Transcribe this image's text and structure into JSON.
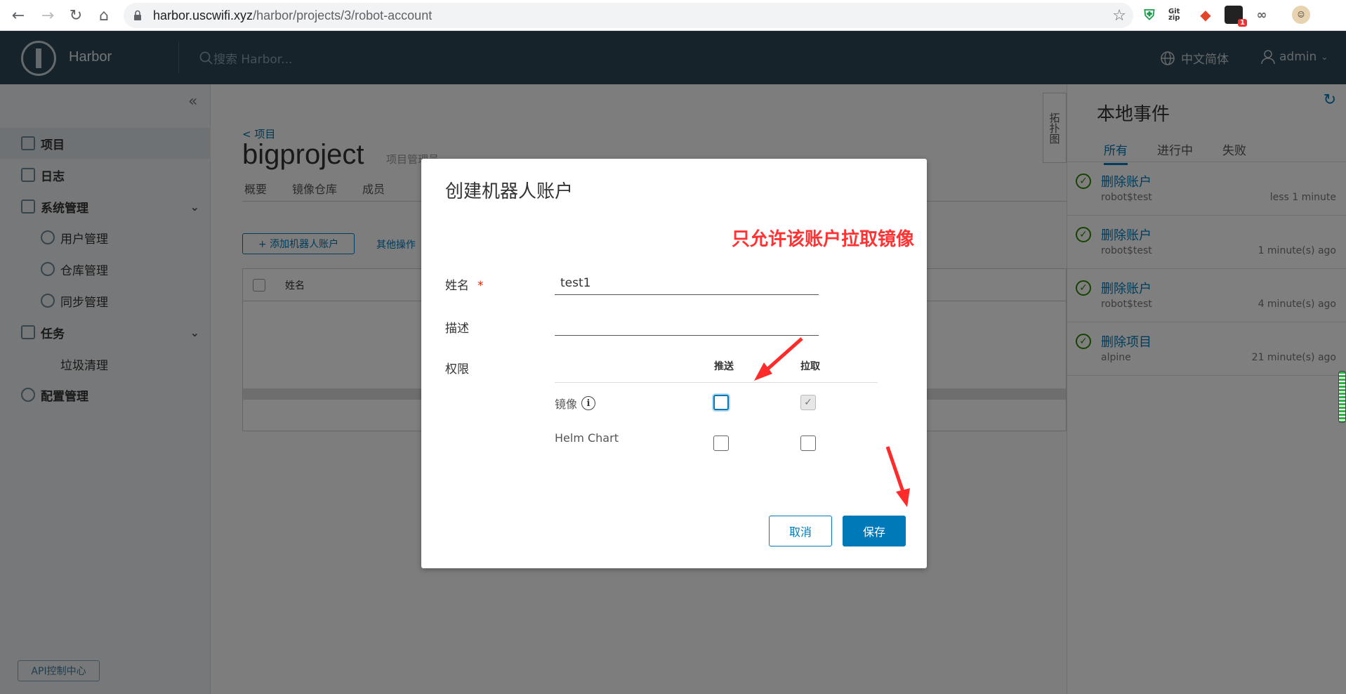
{
  "browser": {
    "url_host": "harbor.uscwifi.xyz",
    "url_path": "/harbor/projects/3/robot-account",
    "ext_gitzip": "Git zip",
    "ext_badge": "1"
  },
  "header": {
    "app_name": "Harbor",
    "search_placeholder": "搜索 Harbor...",
    "language": "中文简体",
    "user": "admin"
  },
  "sidebar": {
    "items": [
      {
        "label": "项目"
      },
      {
        "label": "日志"
      },
      {
        "label": "系统管理"
      },
      {
        "label": "用户管理"
      },
      {
        "label": "仓库管理"
      },
      {
        "label": "同步管理"
      },
      {
        "label": "任务"
      },
      {
        "label": "垃圾清理"
      },
      {
        "label": "配置管理"
      }
    ],
    "api_button": "API控制中心"
  },
  "main": {
    "breadcrumb": "< 项目",
    "project_name": "bigproject",
    "project_role": "项目管理员",
    "tabs": [
      "概要",
      "镜像仓库",
      "成员"
    ],
    "add_robot_button": "+ 添加机器人账户",
    "more_ops": "其他操作",
    "table_col_name": "姓名",
    "side_tab": "拓扑图"
  },
  "events": {
    "title": "本地事件",
    "tabs": [
      "所有",
      "进行中",
      "失败"
    ],
    "items": [
      {
        "name": "删除账户",
        "sub": "robot$test",
        "time": "less 1 minute"
      },
      {
        "name": "删除账户",
        "sub": "robot$test",
        "time": "1 minute(s) ago"
      },
      {
        "name": "删除账户",
        "sub": "robot$test",
        "time": "4 minute(s) ago"
      },
      {
        "name": "删除项目",
        "sub": "alpine",
        "time": "21 minute(s) ago"
      }
    ]
  },
  "modal": {
    "title": "创建机器人账户",
    "annotation": "只允许该账户拉取镜像",
    "name_label": "姓名",
    "required_mark": "*",
    "name_value": "test1",
    "desc_label": "描述",
    "desc_value": "",
    "perm_label": "权限",
    "col_push": "推送",
    "col_pull": "拉取",
    "rows": [
      {
        "label": "镜像",
        "push": false,
        "pull": true
      },
      {
        "label": "Helm Chart",
        "push": false,
        "pull": false
      }
    ],
    "cancel": "取消",
    "save": "保存"
  },
  "colors": {
    "header_bg": "#2d4654",
    "accent": "#0079b8",
    "annotation": "#ff3333"
  }
}
